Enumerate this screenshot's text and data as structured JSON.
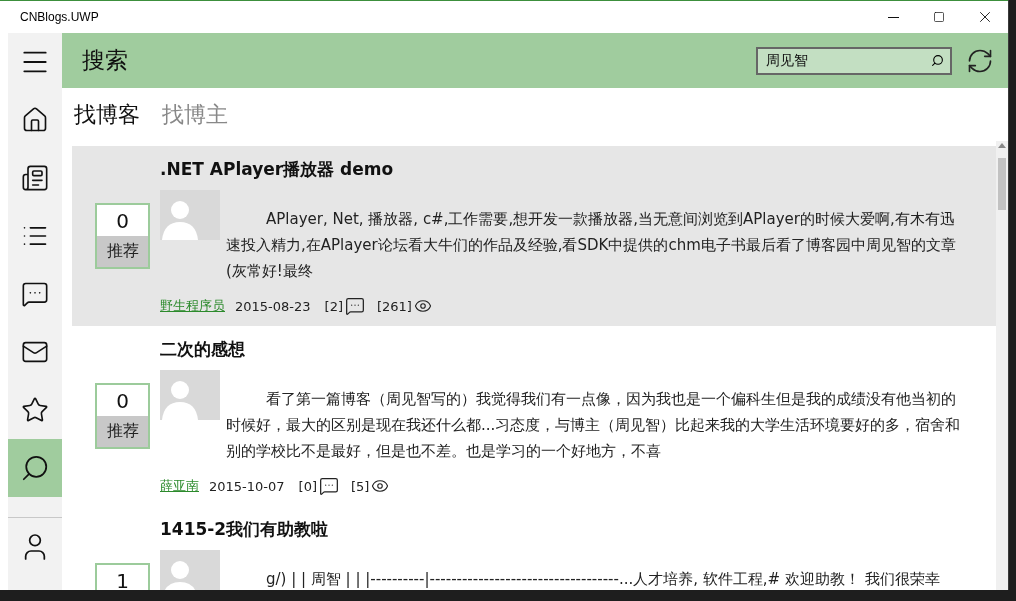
{
  "window": {
    "title": "CNBlogs.UWP"
  },
  "sidebar": {
    "items": [
      {
        "kind": "home",
        "selected": false
      },
      {
        "kind": "news",
        "selected": false
      },
      {
        "kind": "list",
        "selected": false
      },
      {
        "kind": "chat",
        "selected": false
      },
      {
        "kind": "mail",
        "selected": false
      },
      {
        "kind": "star",
        "selected": false
      },
      {
        "kind": "search",
        "selected": true
      }
    ]
  },
  "header": {
    "title": "搜索",
    "search": {
      "value": "周见智"
    }
  },
  "tabs": [
    {
      "label": "找博客",
      "selected": true
    },
    {
      "label": "找博主",
      "selected": false
    }
  ],
  "posts": [
    {
      "title": ".NET APlayer播放器 demo",
      "votes": "0",
      "vote_label": "推荐",
      "summary": "APlayer, Net, 播放器, c#,工作需要,想开发一款播放器,当无意间浏览到APlayer的时候大爱啊,有木有迅速投入精力,在APlayer论坛看大牛们的作品及经验,看SDK中提供的chm电子书最后看了博客园中周见智的文章(灰常好!最终",
      "author": "野生程序员",
      "date": "2015-08-23",
      "comments": "[2]",
      "views": "[261]",
      "selected": true
    },
    {
      "title": "二次的感想",
      "votes": "0",
      "vote_label": "推荐",
      "summary": "看了第一篇博客（周见智写的）我觉得我们有一点像，因为我也是一个偏科生但是我的成绩没有他当初的时候好，最大的区别是现在我还什么都...习态度，与博主（周见智）比起来我的大学生活环境要好的多，宿舍和别的学校比不是最好，但是也不差。也是学习的一个好地方，不喜",
      "author": "薛亚南",
      "date": "2015-10-07",
      "comments": "[0]",
      "views": "[5]",
      "selected": false
    },
    {
      "title": "1415-2我们有助教啦",
      "votes": "1",
      "summary": "g/) | | 周智 | | |----------|-----------------------------------...人才培养, 软件工程,# 欢迎助教！ 我们很荣幸",
      "selected": false
    }
  ]
}
